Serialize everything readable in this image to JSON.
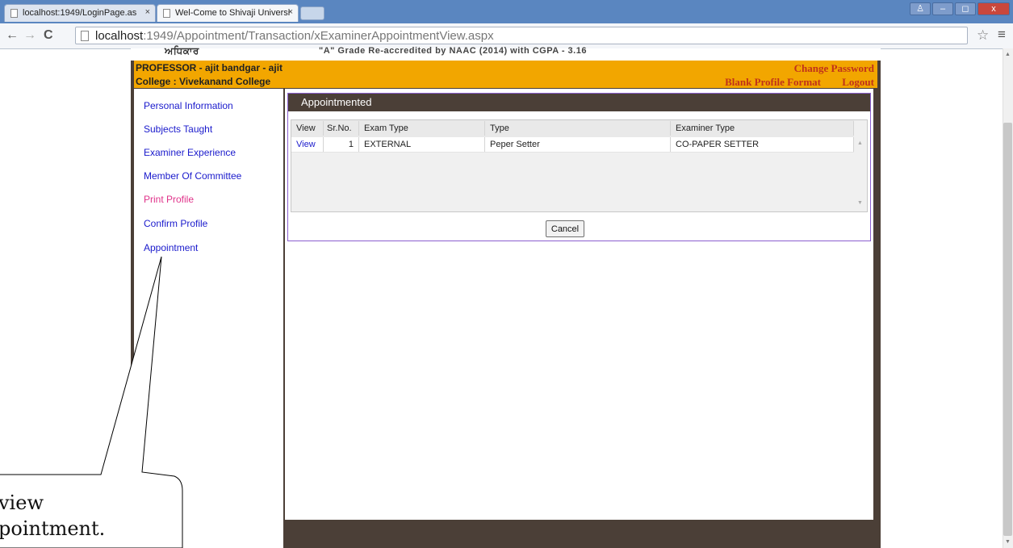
{
  "browser": {
    "tabs": [
      {
        "title": "localhost:1949/LoginPage.as",
        "close": "×"
      },
      {
        "title": "Wel-Come to Shivaji Universi",
        "close": "×"
      }
    ],
    "window_buttons": {
      "user": "♙",
      "minimize": "–",
      "maximize": "◻",
      "close": "x"
    },
    "nav": {
      "back": "←",
      "forward": "→",
      "reload": "C"
    },
    "url_host": "localhost",
    "url_rest": ":1949/Appointment/Transaction/xExaminerAppointmentView.aspx",
    "star": "☆",
    "menu": "≡"
  },
  "header": {
    "logo_fragment": "ਅਧਿਕਾਰ",
    "accreditation": "\"A\" Grade Re-accredited by NAAC (2014) with CGPA - 3.16",
    "professor": "PROFESSOR - ajit bandgar - ajit",
    "college": "College : Vivekanand College",
    "change_password": "Change Password",
    "blank_profile": "Blank Profile Format",
    "logout": "Logout"
  },
  "sidebar": {
    "items": [
      {
        "label": "Personal Information"
      },
      {
        "label": "Subjects Taught"
      },
      {
        "label": "Examiner Experience"
      },
      {
        "label": "Member Of Committee"
      },
      {
        "label": "Print Profile"
      },
      {
        "label": "Confirm Profile"
      },
      {
        "label": "Appointment"
      }
    ]
  },
  "panel": {
    "title": "Appointmented",
    "columns": [
      "View",
      "Sr.No.",
      "Exam Type",
      "Type",
      "Examiner Type"
    ],
    "rows": [
      {
        "view": "View",
        "srno": "1",
        "exam_type": "EXTERNAL",
        "type": "Peper Setter",
        "examiner_type": "CO-PAPER SETTER"
      }
    ],
    "cancel": "Cancel"
  },
  "callout": {
    "line1": "view",
    "line2": "pointment."
  },
  "colors": {
    "titlebar": "#5a86c0",
    "header_band": "#f2a600",
    "page_frame": "#4b3f37",
    "link": "#1a1acc",
    "print_link": "#e0338a",
    "header_link": "#c0321a",
    "panel_border": "#8b5fd0"
  }
}
